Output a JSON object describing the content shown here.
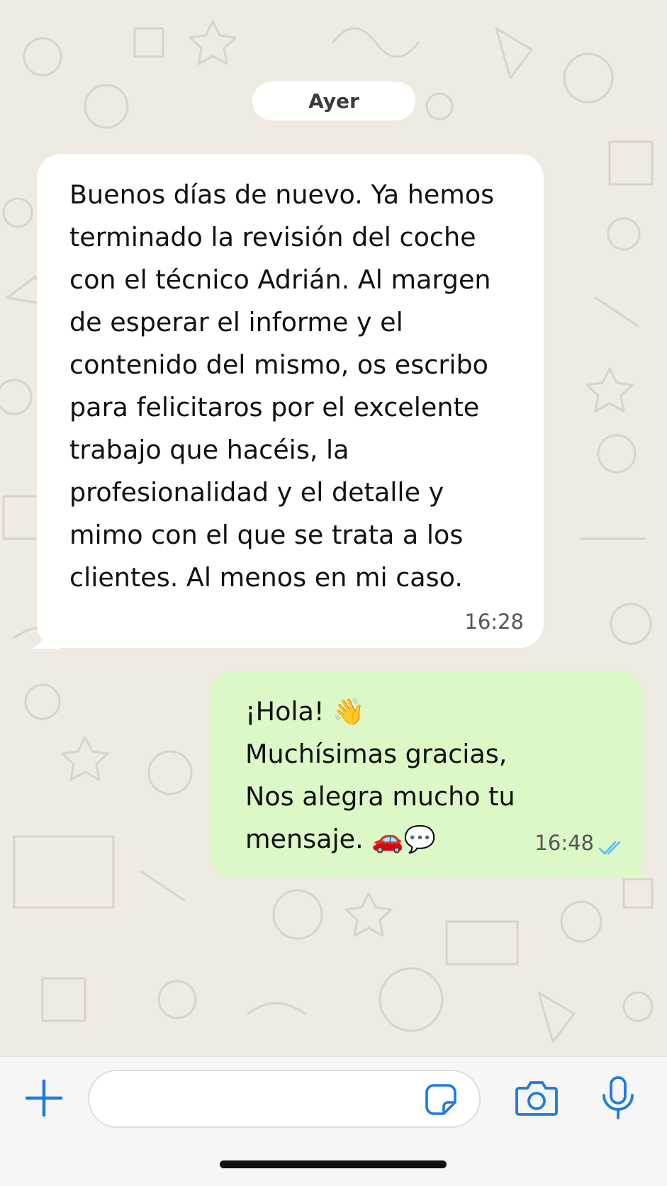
{
  "chat": {
    "date_separator": "Ayer",
    "messages": [
      {
        "direction": "incoming",
        "text": "Buenos días de nuevo. Ya hemos\nterminado la revisión del coche\ncon el técnico Adrián. Al margen\nde esperar el informe y el\ncontenido del mismo, os escribo\npara felicitaros por el excelente\ntrabajo que hacéis, la\nprofesionalidad y el detalle y\nmimo con el que se trata a los\nclientes. Al menos en mi caso.",
        "time": "16:28"
      },
      {
        "direction": "outgoing",
        "text": "¡Hola! 👋\nMuchísimas gracias,\nNos alegra mucho tu\nmensaje. 🚗💬",
        "time": "16:48",
        "status_icon": "double-check-read-icon"
      }
    ]
  },
  "input_bar": {
    "placeholder": "",
    "icons": [
      "plus-icon",
      "sticker-icon",
      "camera-icon",
      "microphone-icon"
    ]
  },
  "colors": {
    "wallpaper": "#efeae2",
    "incoming_bubble": "#ffffff",
    "outgoing_bubble": "#dcf8c6",
    "accent_blue": "#1f7ae0",
    "read_ticks": "#53bdeb"
  }
}
